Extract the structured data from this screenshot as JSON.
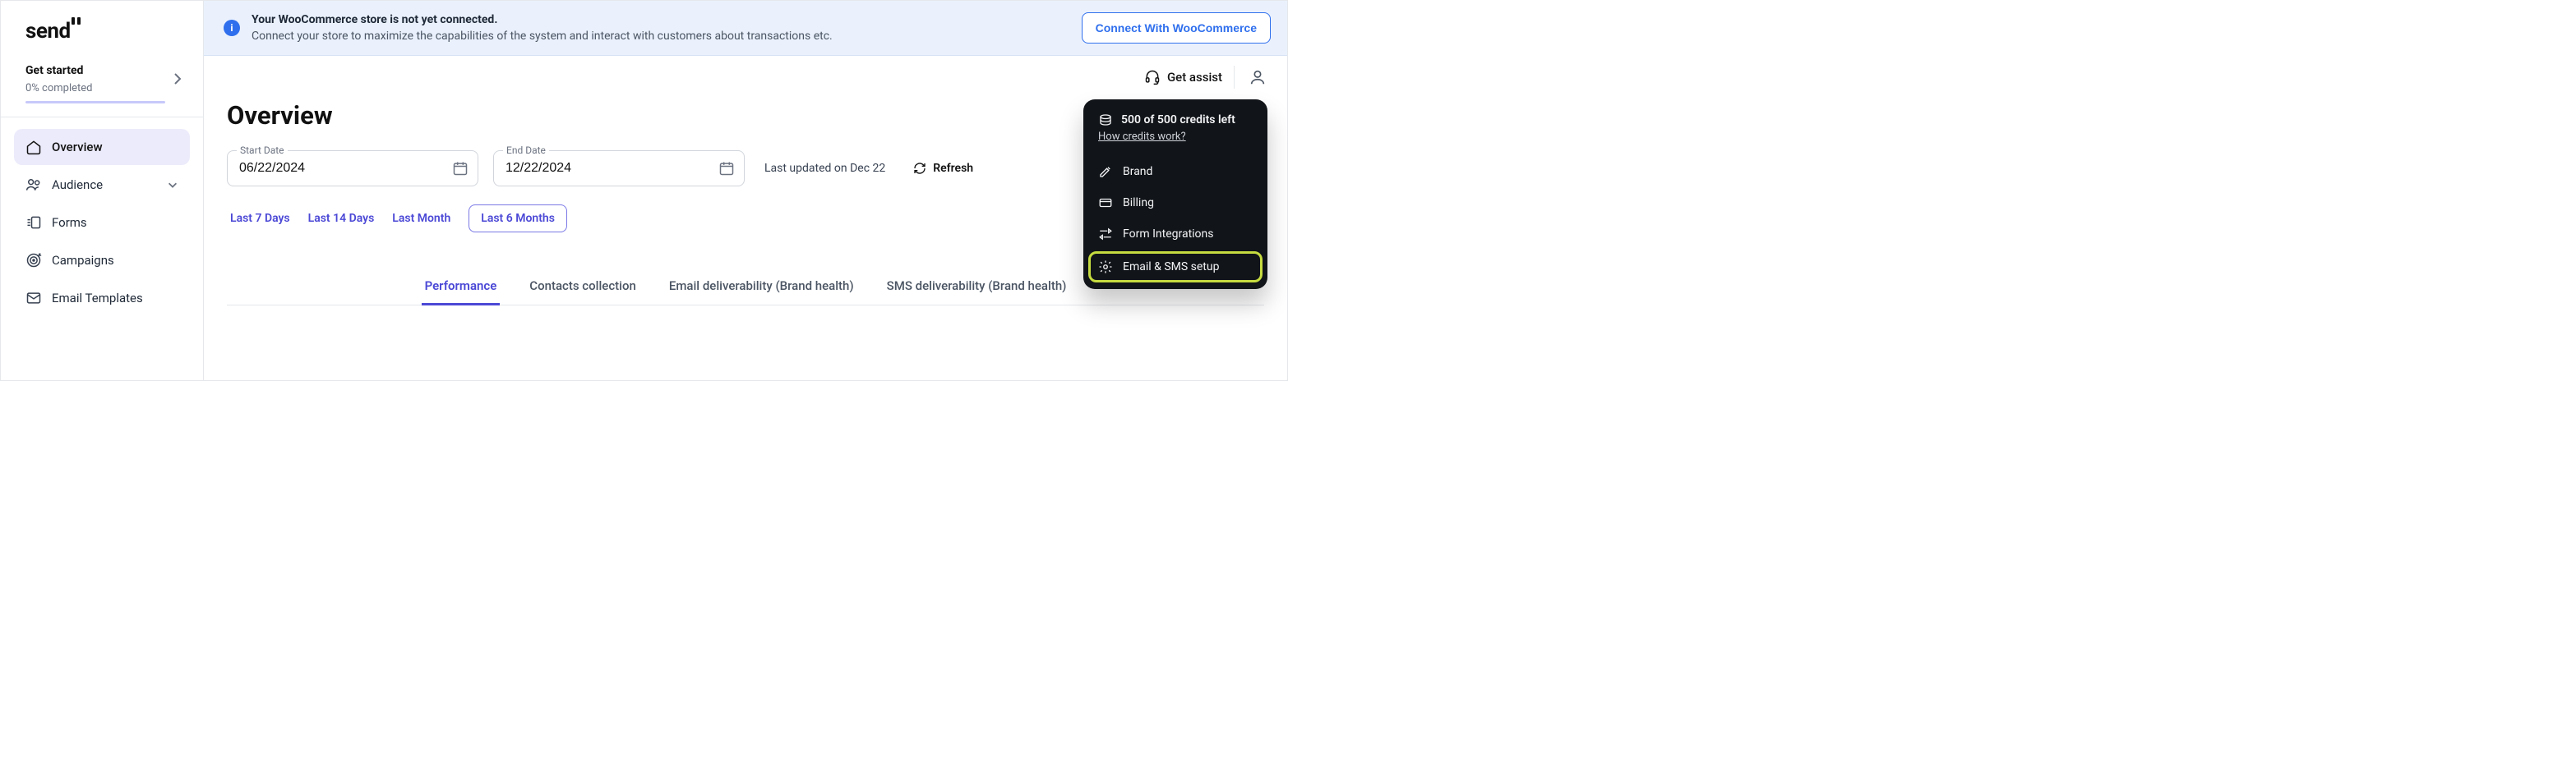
{
  "logo": "send",
  "sidebar": {
    "get_started": {
      "title": "Get started",
      "progress": "0% completed"
    },
    "items": [
      {
        "label": "Overview"
      },
      {
        "label": "Audience"
      },
      {
        "label": "Forms"
      },
      {
        "label": "Campaigns"
      },
      {
        "label": "Email Templates"
      }
    ]
  },
  "banner": {
    "title": "Your WooCommerce store is not yet connected.",
    "subtitle": "Connect your store to maximize the capabilities of the system and interact with customers about transactions etc.",
    "cta": "Connect With WooCommerce"
  },
  "topbar": {
    "assist": "Get assist"
  },
  "page": {
    "title": "Overview"
  },
  "dates": {
    "start_label": "Start Date",
    "start_value": "06/22/2024",
    "end_label": "End Date",
    "end_value": "12/22/2024",
    "updated": "Last updated on Dec 22",
    "refresh": "Refresh"
  },
  "quick_filters": [
    "Last 7 Days",
    "Last 14 Days",
    "Last Month",
    "Last 6 Months"
  ],
  "tabs": [
    "Performance",
    "Contacts collection",
    "Email deliverability (Brand health)",
    "SMS deliverability (Brand health)"
  ],
  "dropdown": {
    "credits": "500 of 500 credits left",
    "credits_link": "How credits work?",
    "items": [
      {
        "label": "Brand"
      },
      {
        "label": "Billing"
      },
      {
        "label": "Form Integrations"
      },
      {
        "label": "Email & SMS setup"
      }
    ]
  }
}
